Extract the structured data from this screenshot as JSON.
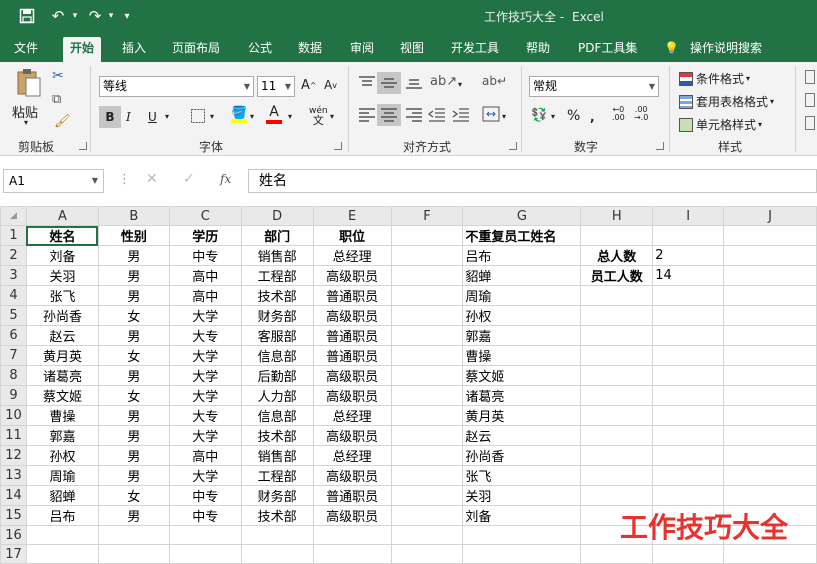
{
  "window": {
    "title": "工作技巧大全",
    "app": "Excel",
    "separator": "-"
  },
  "qat": {
    "save": "save-icon",
    "undo": "undo-icon",
    "redo": "redo-icon",
    "customize": "▾"
  },
  "tabs": [
    "文件",
    "开始",
    "插入",
    "页面布局",
    "公式",
    "数据",
    "审阅",
    "视图",
    "开发工具",
    "帮助",
    "PDF工具集",
    "操作说明搜索"
  ],
  "ribbon": {
    "clipboard": {
      "paste": "粘贴",
      "label": "剪贴板"
    },
    "font": {
      "name": "等线",
      "size": "11",
      "label": "字体",
      "bold": "B",
      "italic": "I",
      "underline": "U"
    },
    "align": {
      "label": "对齐方式"
    },
    "number": {
      "format": "常规",
      "label": "数字"
    },
    "styles": {
      "cond": "条件格式",
      "table": "套用表格格式",
      "cell": "单元格样式",
      "label": "样式"
    }
  },
  "formula_bar": {
    "name_box": "A1",
    "fx": "fx",
    "value": "姓名"
  },
  "sheet": {
    "columns": [
      "A",
      "B",
      "C",
      "D",
      "E",
      "F",
      "G",
      "H",
      "I",
      "J"
    ],
    "headers": {
      "name": "姓名",
      "gender": "性别",
      "edu": "学历",
      "dept": "部门",
      "pos": "职位",
      "unique": "不重复员工姓名"
    },
    "rows": [
      {
        "a": "刘备",
        "b": "男",
        "c": "中专",
        "d": "销售部",
        "e": "总经理",
        "g": "吕布",
        "h": "总人数",
        "i": "2"
      },
      {
        "a": "关羽",
        "b": "男",
        "c": "高中",
        "d": "工程部",
        "e": "高级职员",
        "g": "貂蝉",
        "h": "员工人数",
        "i": "14"
      },
      {
        "a": "张飞",
        "b": "男",
        "c": "高中",
        "d": "技术部",
        "e": "普通职员",
        "g": "周瑜"
      },
      {
        "a": "孙尚香",
        "b": "女",
        "c": "大学",
        "d": "财务部",
        "e": "高级职员",
        "g": "孙权"
      },
      {
        "a": "赵云",
        "b": "男",
        "c": "大专",
        "d": "客服部",
        "e": "普通职员",
        "g": "郭嘉"
      },
      {
        "a": "黄月英",
        "b": "女",
        "c": "大学",
        "d": "信息部",
        "e": "普通职员",
        "g": "曹操"
      },
      {
        "a": "诸葛亮",
        "b": "男",
        "c": "大学",
        "d": "后勤部",
        "e": "高级职员",
        "g": "蔡文姬"
      },
      {
        "a": "蔡文姬",
        "b": "女",
        "c": "大学",
        "d": "人力部",
        "e": "高级职员",
        "g": "诸葛亮"
      },
      {
        "a": "曹操",
        "b": "男",
        "c": "大专",
        "d": "信息部",
        "e": "总经理",
        "g": "黄月英"
      },
      {
        "a": "郭嘉",
        "b": "男",
        "c": "大学",
        "d": "技术部",
        "e": "高级职员",
        "g": "赵云"
      },
      {
        "a": "孙权",
        "b": "男",
        "c": "高中",
        "d": "销售部",
        "e": "总经理",
        "g": "孙尚香"
      },
      {
        "a": "周瑜",
        "b": "男",
        "c": "大学",
        "d": "工程部",
        "e": "高级职员",
        "g": "张飞"
      },
      {
        "a": "貂蝉",
        "b": "女",
        "c": "中专",
        "d": "财务部",
        "e": "普通职员",
        "g": "关羽"
      },
      {
        "a": "吕布",
        "b": "男",
        "c": "中专",
        "d": "技术部",
        "e": "高级职员",
        "g": "刘备"
      }
    ]
  },
  "watermark": "工作技巧大全"
}
